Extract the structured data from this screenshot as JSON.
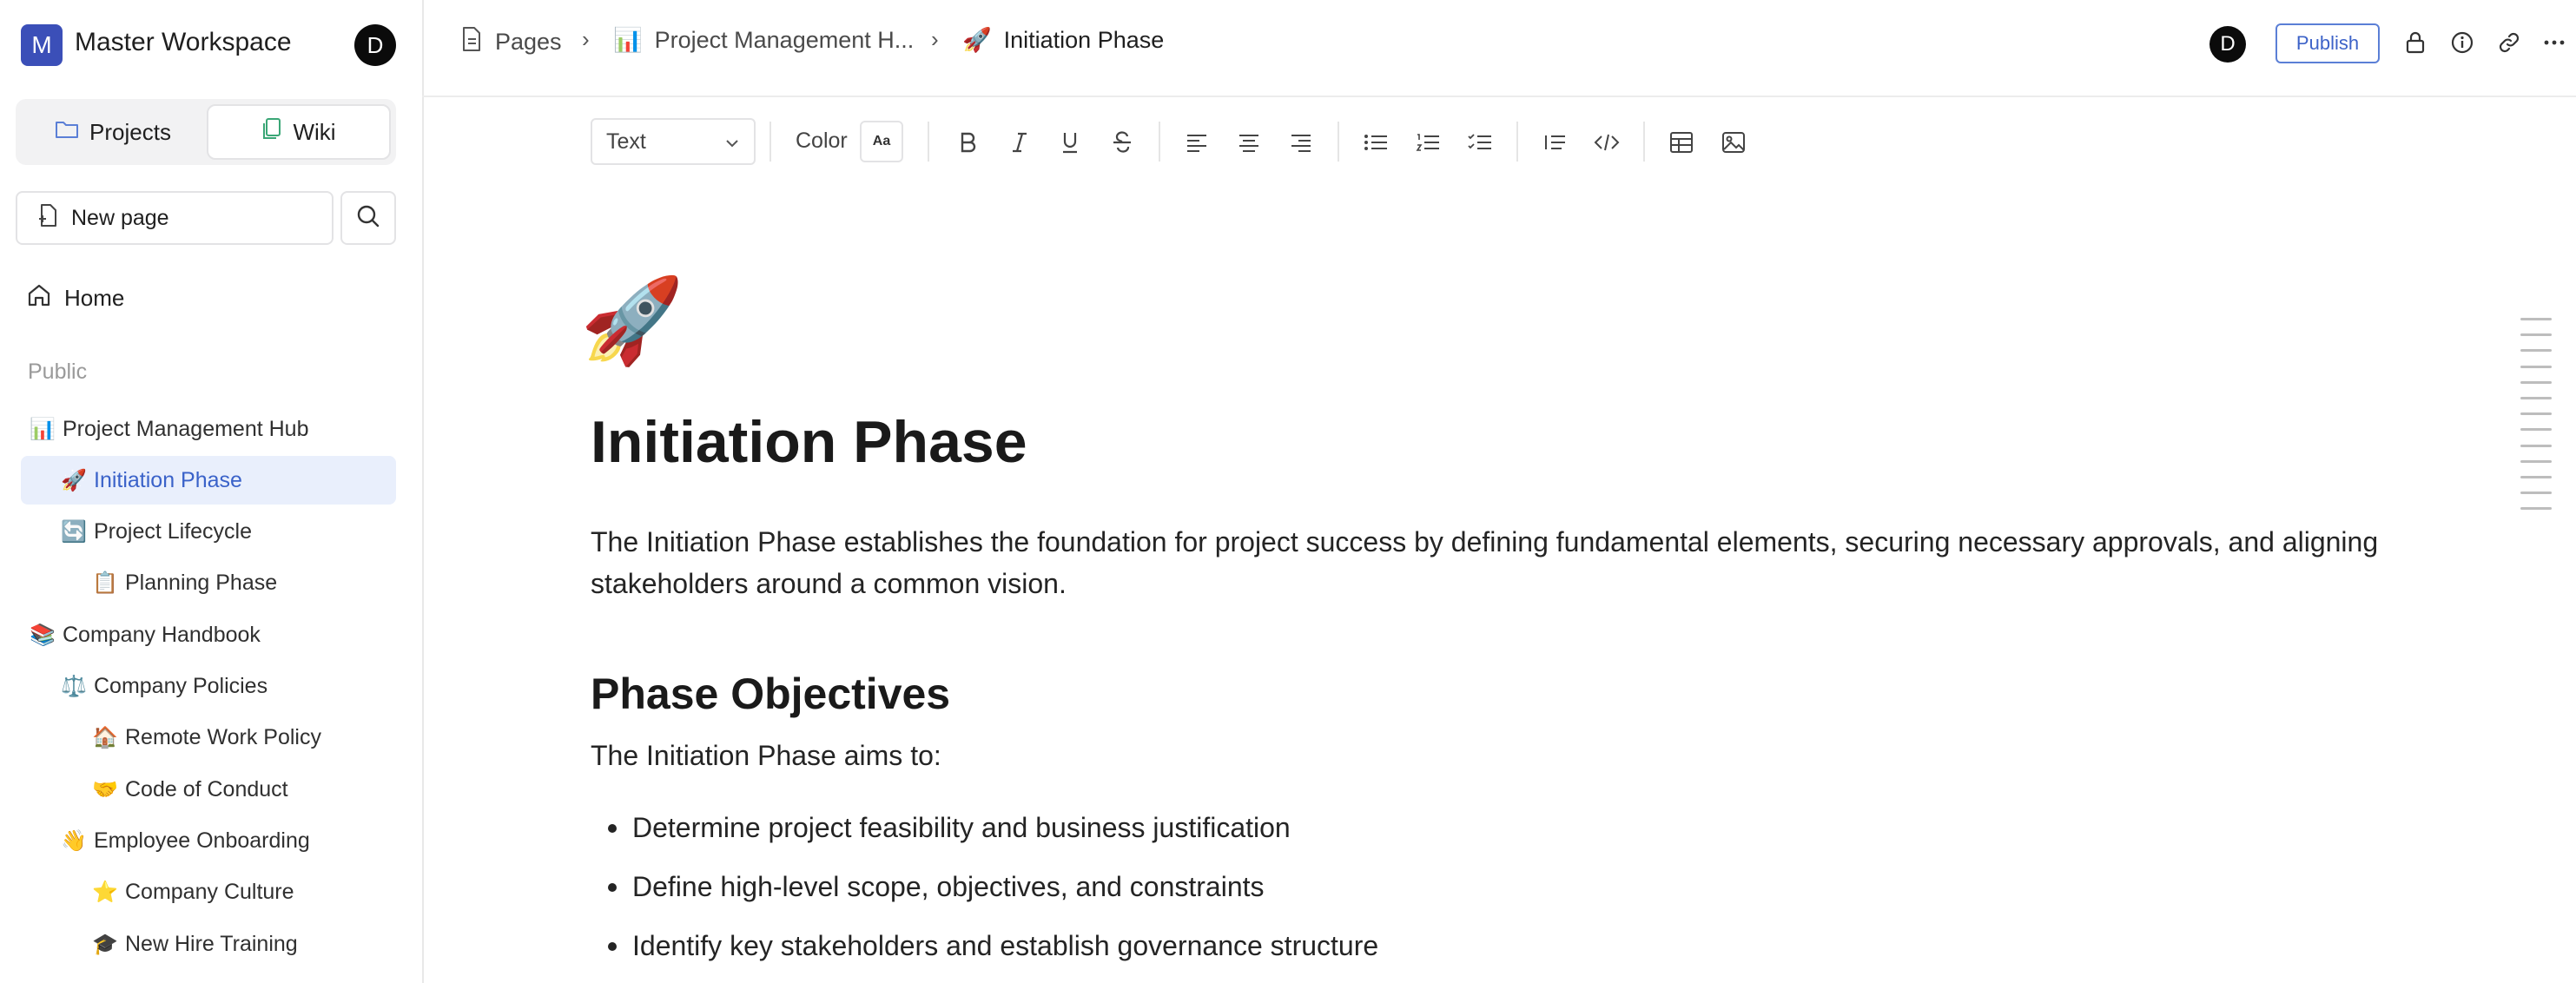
{
  "workspace": {
    "logo_letter": "M",
    "name": "Master Workspace",
    "avatar_letter": "D"
  },
  "sidebar": {
    "tabs": [
      {
        "label": "Projects",
        "icon": "folder-icon"
      },
      {
        "label": "Wiki",
        "icon": "pages-icon"
      }
    ],
    "new_page_label": "New page",
    "home_label": "Home",
    "section_label": "Public",
    "tree": [
      {
        "emoji": "📊",
        "label": "Project Management Hub",
        "level": 0,
        "active": false
      },
      {
        "emoji": "🚀",
        "label": "Initiation Phase",
        "level": 1,
        "active": true
      },
      {
        "emoji": "🔄",
        "label": "Project Lifecycle",
        "level": 1,
        "active": false
      },
      {
        "emoji": "📋",
        "label": "Planning Phase",
        "level": 2,
        "active": false
      },
      {
        "emoji": "📚",
        "label": "Company Handbook",
        "level": 0,
        "active": false
      },
      {
        "emoji": "⚖️",
        "label": "Company Policies",
        "level": 1,
        "active": false
      },
      {
        "emoji": "🏠",
        "label": "Remote Work Policy",
        "level": 2,
        "active": false
      },
      {
        "emoji": "🤝",
        "label": "Code of Conduct",
        "level": 2,
        "active": false
      },
      {
        "emoji": "👋",
        "label": "Employee Onboarding",
        "level": 1,
        "active": false
      },
      {
        "emoji": "⭐",
        "label": "Company Culture",
        "level": 2,
        "active": false
      },
      {
        "emoji": "🎓",
        "label": "New Hire Training",
        "level": 2,
        "active": false
      }
    ]
  },
  "breadcrumb": {
    "pages_label": "Pages",
    "parent_emoji": "📊",
    "parent_label": "Project Management H...",
    "current_emoji": "🚀",
    "current_label": "Initiation Phase"
  },
  "header": {
    "avatar_letter": "D",
    "publish_label": "Publish"
  },
  "toolbar": {
    "block_type": "Text",
    "color_label": "Color",
    "color_swatch": "Aa"
  },
  "document": {
    "icon_emoji": "🚀",
    "title": "Initiation Phase",
    "intro": "The Initiation Phase establishes the foundation for project success by defining fundamental elements, securing necessary approvals, and aligning stakeholders around a common vision.",
    "section_heading": "Phase Objectives",
    "section_lead": "The Initiation Phase aims to:",
    "objectives": [
      "Determine project feasibility and business justification",
      "Define high-level scope, objectives, and constraints",
      "Identify key stakeholders and establish governance structure"
    ]
  },
  "colors": {
    "accent": "#3b4fb8",
    "active_bg": "#e9effc",
    "active_text": "#3a62c9",
    "publish_border": "#5b7fd6"
  }
}
